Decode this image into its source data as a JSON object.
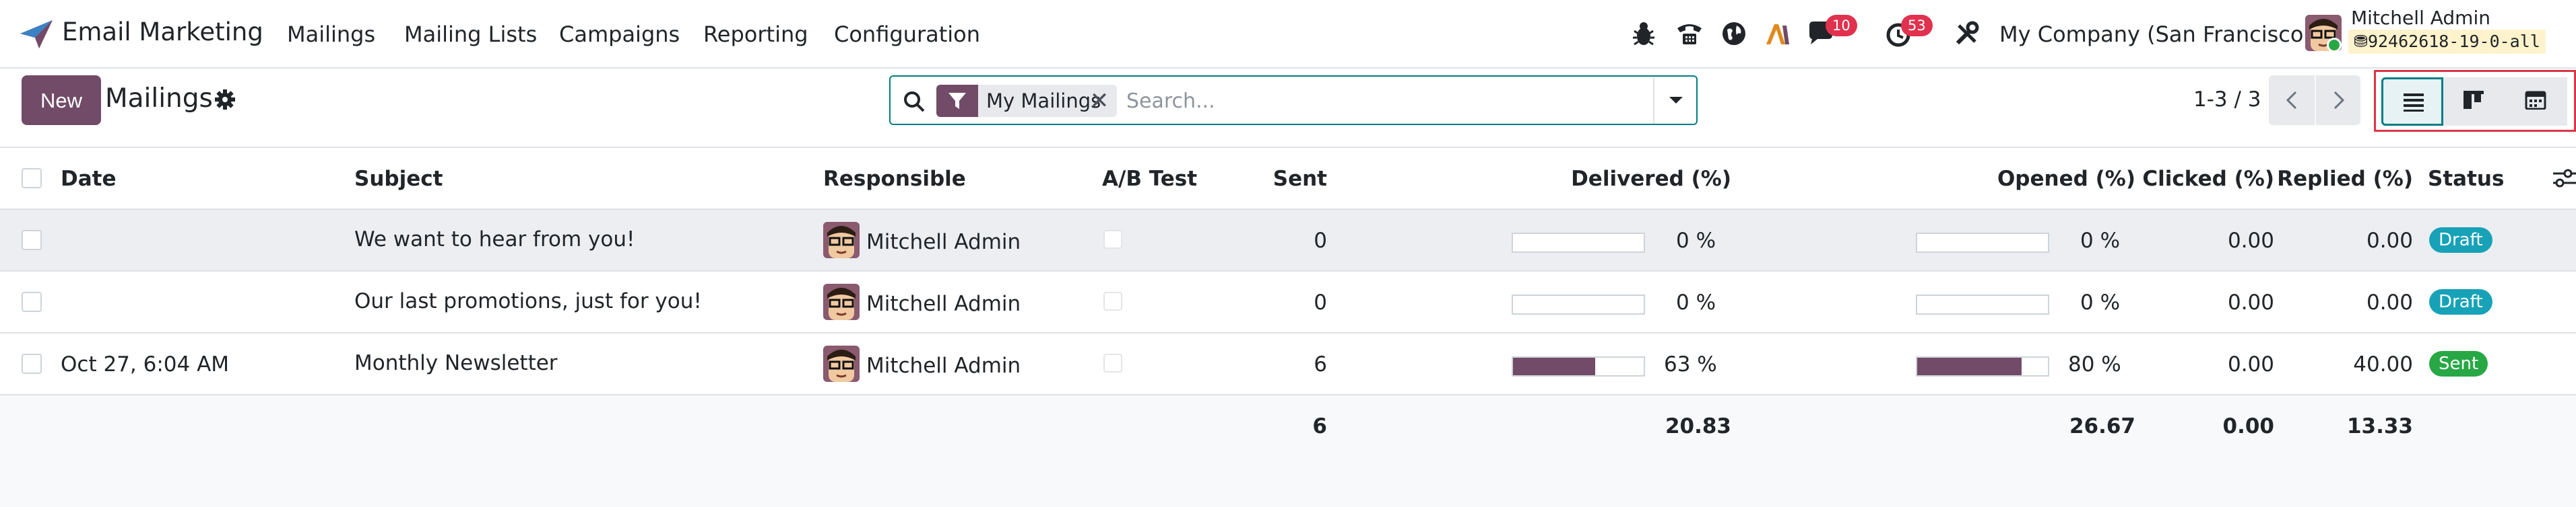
{
  "app": {
    "name": "Email Marketing"
  },
  "menu": [
    "Mailings",
    "Mailing Lists",
    "Campaigns",
    "Reporting",
    "Configuration"
  ],
  "systray": {
    "messages_count": "10",
    "activities_count": "53",
    "company": "My Company (San Francisco)",
    "user_name": "Mitchell Admin",
    "database": "92462618-19-0-all"
  },
  "control": {
    "new_label": "New",
    "title": "Mailings",
    "search": {
      "facet": "My Mailings",
      "placeholder": "Search..."
    },
    "pager": "1-3 / 3"
  },
  "table": {
    "headers": {
      "date": "Date",
      "subject": "Subject",
      "responsible": "Responsible",
      "ab_test": "A/B Test",
      "sent": "Sent",
      "delivered": "Delivered (%)",
      "opened": "Opened (%)",
      "clicked": "Clicked (%)",
      "replied": "Replied (%)",
      "status": "Status"
    },
    "rows": [
      {
        "date": "",
        "subject": "We want to hear from you!",
        "responsible": "Mitchell Admin",
        "sent": "0",
        "delivered": 0,
        "delivered_label": "0 %",
        "opened": 0,
        "opened_label": "0 %",
        "clicked": "0.00",
        "replied": "0.00",
        "status": "Draft"
      },
      {
        "date": "",
        "subject": "Our last promotions, just for you!",
        "responsible": "Mitchell Admin",
        "sent": "0",
        "delivered": 0,
        "delivered_label": "0 %",
        "opened": 0,
        "opened_label": "0 %",
        "clicked": "0.00",
        "replied": "0.00",
        "status": "Draft"
      },
      {
        "date": "Oct 27, 6:04 AM",
        "subject": "Monthly Newsletter",
        "responsible": "Mitchell Admin",
        "sent": "6",
        "delivered": 63,
        "delivered_label": "63 %",
        "opened": 80,
        "opened_label": "80 %",
        "clicked": "0.00",
        "replied": "40.00",
        "status": "Sent"
      }
    ],
    "totals": {
      "sent": "6",
      "delivered": "20.83",
      "opened": "26.67",
      "clicked": "0.00",
      "replied": "13.33"
    }
  },
  "colors": {
    "brand": "#714b67",
    "accent": "#017e84",
    "draft": "#17a2b8",
    "sent": "#28a745",
    "badge": "#e0324e"
  },
  "icons": [
    "app-logo-icon",
    "bug-icon",
    "phone-icon",
    "globe-icon",
    "ai-icon",
    "chat-icon",
    "clock-icon",
    "tools-icon",
    "gear-icon",
    "search-icon",
    "filter-icon",
    "chevron-down-icon",
    "chevron-left-icon",
    "chevron-right-icon",
    "list-view-icon",
    "kanban-view-icon",
    "calendar-view-icon",
    "optional-columns-icon"
  ]
}
